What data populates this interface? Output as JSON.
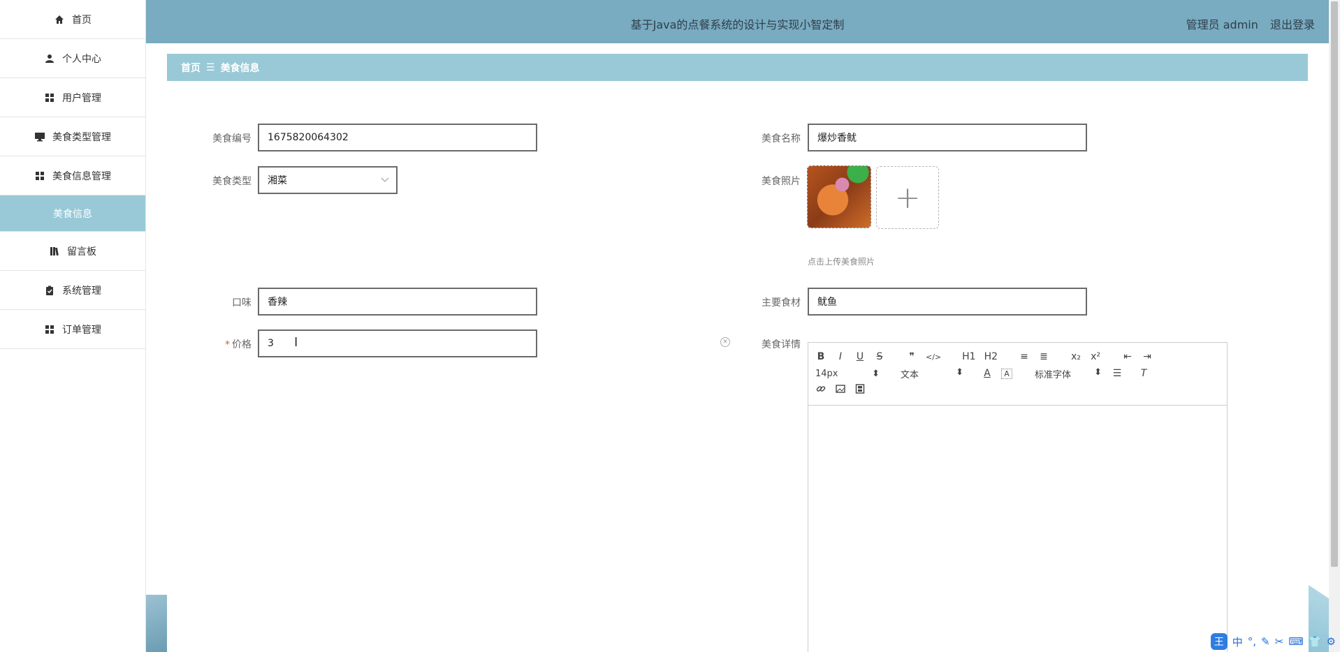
{
  "sidebar": {
    "items": [
      {
        "label": "首页",
        "icon": "home-icon"
      },
      {
        "label": "个人中心",
        "icon": "user-icon"
      },
      {
        "label": "用户管理",
        "icon": "grid-icon"
      },
      {
        "label": "美食类型管理",
        "icon": "monitor-icon"
      },
      {
        "label": "美食信息管理",
        "icon": "grid-icon"
      },
      {
        "label": "美食信息",
        "icon": "",
        "active": true
      },
      {
        "label": "留言板",
        "icon": "book-icon"
      },
      {
        "label": "系统管理",
        "icon": "clipboard-icon"
      },
      {
        "label": "订单管理",
        "icon": "grid-icon"
      }
    ]
  },
  "header": {
    "title": "基于Java的点餐系统的设计与实现小智定制",
    "user": "管理员 admin",
    "logout": "退出登录"
  },
  "breadcrumb": {
    "home": "首页",
    "separator": "☰",
    "current": "美食信息"
  },
  "form": {
    "food_no": {
      "label": "美食编号",
      "value": "1675820064302"
    },
    "food_name": {
      "label": "美食名称",
      "value": "爆炒香鱿"
    },
    "food_type": {
      "label": "美食类型",
      "value": "湘菜"
    },
    "food_photo": {
      "label": "美食照片",
      "hint": "点击上传美食照片"
    },
    "taste": {
      "label": "口味",
      "value": "香辣"
    },
    "main_ingredient": {
      "label": "主要食材",
      "value": "鱿鱼"
    },
    "price": {
      "label": "价格",
      "required_mark": "*",
      "value": "3"
    },
    "detail": {
      "label": "美食详情"
    }
  },
  "editor": {
    "font_size": "14px",
    "paragraph": "文本",
    "font_family": "标准字体",
    "buttons_row1": [
      "B",
      "I",
      "U",
      "S",
      "❞",
      "</>",
      "H1",
      "H2",
      "≡",
      "≣",
      "x₂",
      "x²",
      "⇤",
      "⇥"
    ]
  },
  "ime": {
    "logo": "王",
    "mode": "中"
  },
  "colors": {
    "topbar": "#79abc1",
    "breadcrumb": "#99c9d7",
    "active_nav": "#99c9d7"
  }
}
